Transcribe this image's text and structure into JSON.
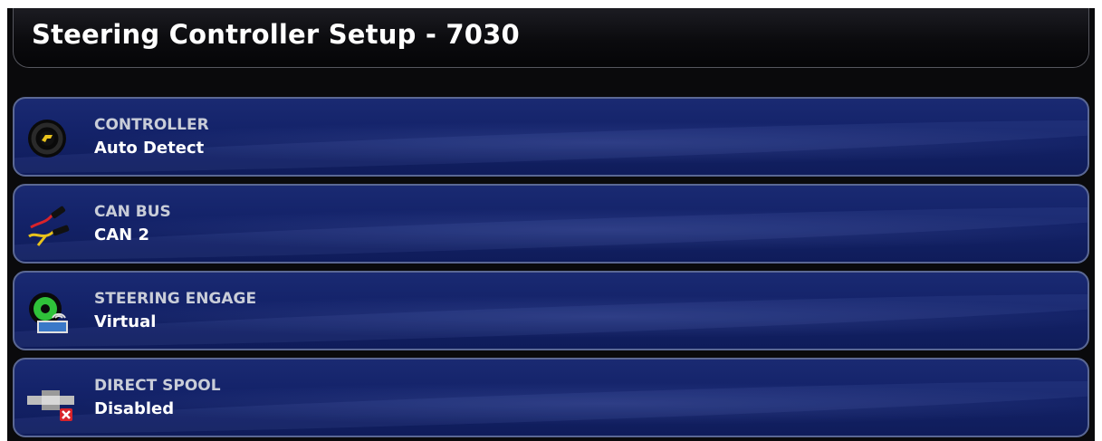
{
  "header": {
    "title": "Steering Controller Setup - 7030"
  },
  "settings": [
    {
      "label": "CONTROLLER",
      "value": "Auto Detect",
      "icon": "steering-wheel-icon"
    },
    {
      "label": "CAN BUS",
      "value": "CAN 2",
      "icon": "cable-connector-icon"
    },
    {
      "label": "STEERING ENGAGE",
      "value": "Virtual",
      "icon": "virtual-engage-icon"
    },
    {
      "label": "DIRECT SPOOL",
      "value": "Disabled",
      "icon": "spool-disabled-icon"
    }
  ],
  "colors": {
    "row_background": "#14236a",
    "row_border": "#5b6894",
    "title_background": "#0b0b0e",
    "label_text": "#c9cdd8",
    "value_text": "#ffffff",
    "accent_yellow": "#e8c21c",
    "accent_green": "#2fc23a",
    "disabled_red": "#d8232a"
  }
}
